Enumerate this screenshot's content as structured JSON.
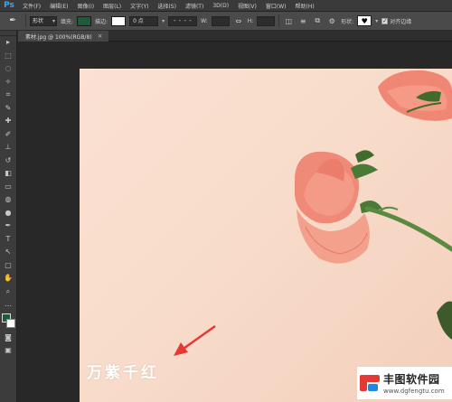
{
  "app": {
    "logo": "Ps"
  },
  "menu": [
    {
      "label": "文件(F)"
    },
    {
      "label": "编辑(E)"
    },
    {
      "label": "图像(I)"
    },
    {
      "label": "图层(L)"
    },
    {
      "label": "文字(Y)"
    },
    {
      "label": "选择(S)"
    },
    {
      "label": "滤镜(T)"
    },
    {
      "label": "3D(D)"
    },
    {
      "label": "视图(V)"
    },
    {
      "label": "窗口(W)"
    },
    {
      "label": "帮助(H)"
    }
  ],
  "options": {
    "mode_value": "形状",
    "fill_label": "填充:",
    "fill_color": "#1f5a3a",
    "stroke_label": "描边:",
    "stroke_color": "#ffffff",
    "stroke_width": "0 点",
    "dash_glyph": "- - - -",
    "w_label": "W:",
    "h_label": "H:",
    "link_glyph": "⇔",
    "shape_label": "形状:",
    "shape_glyph": "♥",
    "align_edges_label": "对齐边缘",
    "align_checked": "✓"
  },
  "document": {
    "tab_title": "素材.jpg @ 100%(RGB/8)",
    "close_glyph": "×"
  },
  "canvas": {
    "watermark": "万紫千红",
    "background": "#f8dccb",
    "petal_color": "#f08a78",
    "stem_color": "#4e7a3a"
  },
  "colors": {
    "foreground": "#1f5a3a",
    "background": "#ffffff"
  },
  "tools": [
    {
      "name": "move-tool",
      "glyph": "▸"
    },
    {
      "name": "marquee-tool",
      "glyph": "⬚"
    },
    {
      "name": "lasso-tool",
      "glyph": "◌"
    },
    {
      "name": "magic-wand-tool",
      "glyph": "✧"
    },
    {
      "name": "crop-tool",
      "glyph": "⌗"
    },
    {
      "name": "eyedropper-tool",
      "glyph": "✎"
    },
    {
      "name": "healing-tool",
      "glyph": "✚"
    },
    {
      "name": "brush-tool",
      "glyph": "✐"
    },
    {
      "name": "stamp-tool",
      "glyph": "⊥"
    },
    {
      "name": "history-brush-tool",
      "glyph": "↺"
    },
    {
      "name": "eraser-tool",
      "glyph": "◧"
    },
    {
      "name": "gradient-tool",
      "glyph": "▭"
    },
    {
      "name": "blur-tool",
      "glyph": "◍"
    },
    {
      "name": "dodge-tool",
      "glyph": "●"
    },
    {
      "name": "pen-tool",
      "glyph": "✒"
    },
    {
      "name": "type-tool",
      "glyph": "T"
    },
    {
      "name": "path-select-tool",
      "glyph": "↖"
    },
    {
      "name": "shape-tool",
      "glyph": "▢"
    },
    {
      "name": "hand-tool",
      "glyph": "✋"
    },
    {
      "name": "zoom-tool",
      "glyph": "⌕"
    },
    {
      "name": "more-tools",
      "glyph": "…"
    }
  ],
  "site_logo": {
    "title": "丰图软件园",
    "url_text": "www.dgfengtu.com"
  }
}
